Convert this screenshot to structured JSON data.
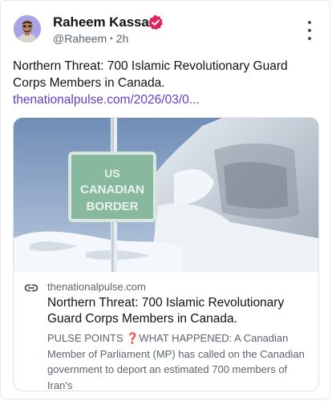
{
  "author": {
    "name": "Raheem Kassam",
    "handle": "@Raheem",
    "separator": "•",
    "time": "2h",
    "verified_color": "#e0245e"
  },
  "post": {
    "text": "Northern Threat: 700 Islamic Revolutionary Guard Corps Members in Canada.",
    "link_text": "thenationalpulse.com/2026/03/0..."
  },
  "link_card": {
    "image_sign_line1": "US",
    "image_sign_line2": "CANADIAN",
    "image_sign_line3": "BORDER",
    "domain": "thenationalpulse.com",
    "title": "Northern Threat: 700 Islamic Revolutionary Guard Corps Members in Canada.",
    "description": "PULSE POINTS ❓WHAT HAPPENED: A Canadian Member of Parliament (MP) has called on the Canadian government to deport an estimated 700 members of Iran's"
  },
  "colors": {
    "link": "#5b3fc8",
    "sign": "#6fa98c"
  },
  "icons": {
    "more": "more-vertical-icon",
    "link": "link-icon",
    "verified": "verified-badge-icon"
  }
}
